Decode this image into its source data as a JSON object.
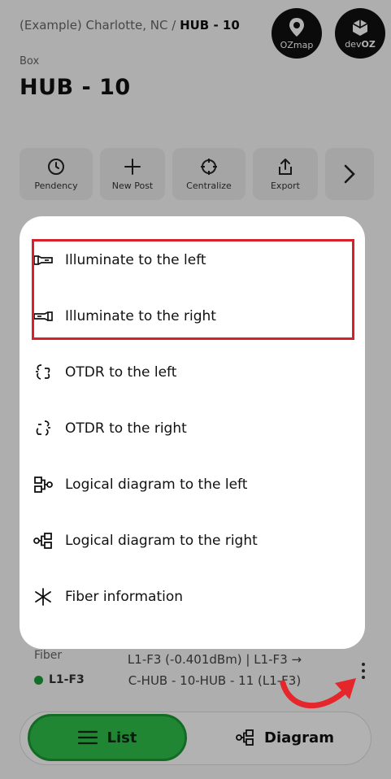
{
  "breadcrumb": {
    "prefix": "(Example) Charlotte, NC /",
    "current": "HUB - 10"
  },
  "logos": {
    "ozmap": "OZmap",
    "devoz_prefix": "dev",
    "devoz_suffix": "OZ"
  },
  "header": {
    "kind": "Box",
    "title": "HUB - 10"
  },
  "toolbar": [
    {
      "label": "Pendency",
      "icon": "clock-icon"
    },
    {
      "label": "New Post",
      "icon": "plus-icon"
    },
    {
      "label": "Centralize",
      "icon": "crosshair-icon"
    },
    {
      "label": "Export",
      "icon": "export-icon"
    },
    {
      "label": "",
      "icon": "chevron-right-icon"
    }
  ],
  "menu": {
    "items": [
      {
        "label": "Illuminate to the left",
        "icon": "flashlight-left-icon"
      },
      {
        "label": "Illuminate to the right",
        "icon": "flashlight-right-icon"
      },
      {
        "label": "OTDR to the left",
        "icon": "otdr-left-icon"
      },
      {
        "label": "OTDR to the right",
        "icon": "otdr-right-icon"
      },
      {
        "label": "Logical diagram to the left",
        "icon": "diagram-left-icon"
      },
      {
        "label": "Logical diagram to the right",
        "icon": "diagram-right-icon"
      },
      {
        "label": "Fiber information",
        "icon": "asterisk-icon"
      }
    ]
  },
  "fiber": {
    "label": "Fiber",
    "tag": "L1-F3",
    "desc_line1": "L1-F3 (-0.401dBm) | L1-F3 →",
    "desc_line2": "C-HUB - 10-HUB - 11 (L1-F3)"
  },
  "bottom": {
    "list_label": "List",
    "diagram_label": "Diagram"
  },
  "colors": {
    "accent_green": "#2ec14b",
    "highlight_red": "#d8202b",
    "arrow_red": "#e5262b"
  }
}
